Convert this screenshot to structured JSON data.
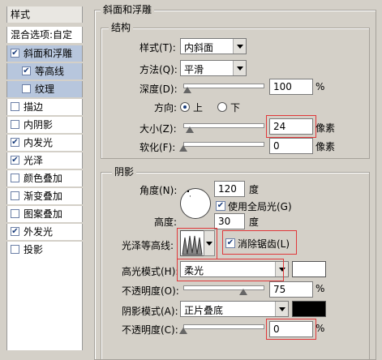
{
  "left_panel": {
    "header": "样式",
    "blend_options": "混合选项:自定",
    "items": [
      {
        "label": "斜面和浮雕",
        "checked": true,
        "selected": true
      },
      {
        "label": "等高线",
        "checked": true,
        "selected": true,
        "sub": true
      },
      {
        "label": "纹理",
        "checked": false,
        "selected": true,
        "sub": true
      },
      {
        "label": "描边",
        "checked": false
      },
      {
        "label": "内阴影",
        "checked": false
      },
      {
        "label": "内发光",
        "checked": true
      },
      {
        "label": "光泽",
        "checked": true
      },
      {
        "label": "颜色叠加",
        "checked": false
      },
      {
        "label": "渐变叠加",
        "checked": false
      },
      {
        "label": "图案叠加",
        "checked": false
      },
      {
        "label": "外发光",
        "checked": true
      },
      {
        "label": "投影",
        "checked": false
      }
    ]
  },
  "panel_title": "斜面和浮雕",
  "structure": {
    "title": "结构",
    "style_label": "样式(T):",
    "style_value": "内斜面",
    "method_label": "方法(Q):",
    "method_value": "平滑",
    "depth_label": "深度(D):",
    "depth_value": "100",
    "depth_unit": "%",
    "depth_level": 0.05,
    "direction_label": "方向:",
    "dir_up": "上",
    "dir_down": "下",
    "size_label": "大小(Z):",
    "size_value": "24",
    "size_unit": "像素",
    "size_level": 0.08,
    "soften_label": "软化(F):",
    "soften_value": "0",
    "soften_unit": "像素"
  },
  "shading": {
    "title": "阴影",
    "angle_label": "角度(N):",
    "angle_value": "120",
    "degree": "度",
    "global_light": "使用全局光(G)",
    "altitude_label": "高度:",
    "altitude_value": "30",
    "gloss_label": "光泽等高线:",
    "antialias": "消除锯齿(L)",
    "highlight_mode_label": "高光模式(H):",
    "highlight_mode_value": "柔光",
    "highlight_color": "#ffffff",
    "opacity1_label": "不透明度(O):",
    "opacity1_value": "75",
    "opacity1_level": 0.75,
    "shadow_mode_label": "阴影模式(A):",
    "shadow_mode_value": "正片叠底",
    "shadow_color": "#000000",
    "opacity2_label": "不透明度(C):",
    "opacity2_value": "0",
    "opacity2_level": 0.0,
    "pct": "%"
  },
  "colors": {
    "highlight_border": "#e0383a",
    "selection": "#b7c6dd"
  }
}
